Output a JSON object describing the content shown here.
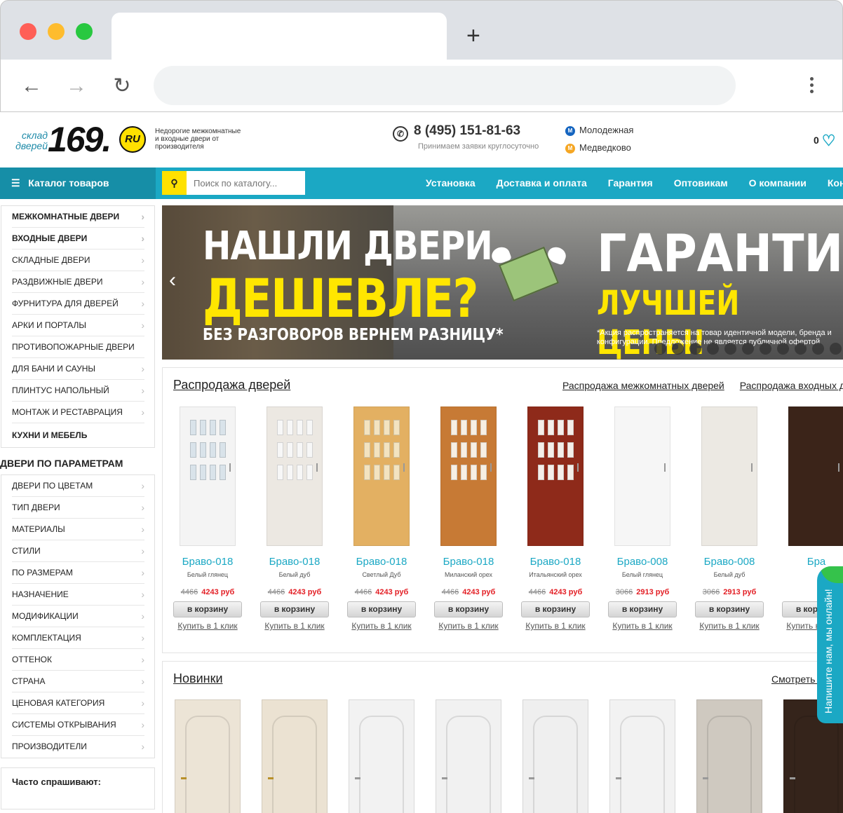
{
  "header": {
    "logo_top": "склад",
    "logo_bottom": "дверей",
    "logo_number": "169.",
    "logo_ru": "RU",
    "tagline": "Недорогие межкомнатные и входные двери от производителя",
    "phone": "8 (495) 151-81-63",
    "phone_note": "Принимаем заявки круглосуточно",
    "metro": [
      {
        "letter": "M",
        "name": "Молодежная",
        "color": "#1565c0"
      },
      {
        "letter": "M",
        "name": "Медведково",
        "color": "#f5a623"
      }
    ],
    "favorites_count": "0"
  },
  "nav": {
    "catalog_label": "Каталог товаров",
    "search_placeholder": "Поиск по каталогу...",
    "menu": [
      "Установка",
      "Доставка и оплата",
      "Гарантия",
      "Оптовикам",
      "О компании",
      "Кон"
    ]
  },
  "sidebar": {
    "catalog": [
      {
        "label": "МЕЖКОМНАТНЫЕ ДВЕРИ",
        "bold": true,
        "arrow": true
      },
      {
        "label": "ВХОДНЫЕ ДВЕРИ",
        "bold": true,
        "arrow": true
      },
      {
        "label": "СКЛАДНЫЕ ДВЕРИ",
        "bold": false,
        "arrow": true
      },
      {
        "label": "РАЗДВИЖНЫЕ ДВЕРИ",
        "bold": false,
        "arrow": true
      },
      {
        "label": "ФУРНИТУРА ДЛЯ ДВЕРЕЙ",
        "bold": false,
        "arrow": true
      },
      {
        "label": "АРКИ И ПОРТАЛЫ",
        "bold": false,
        "arrow": true
      },
      {
        "label": "ПРОТИВОПОЖАРНЫЕ ДВЕРИ",
        "bold": false,
        "arrow": false
      },
      {
        "label": "ДЛЯ БАНИ И САУНЫ",
        "bold": false,
        "arrow": true
      },
      {
        "label": "ПЛИНТУС НАПОЛЬНЫЙ",
        "bold": false,
        "arrow": true
      },
      {
        "label": "МОНТАЖ И РЕСТАВРАЦИЯ",
        "bold": false,
        "arrow": true
      },
      {
        "label": "КУХНИ И МЕБЕЛЬ",
        "bold": true,
        "arrow": false
      }
    ],
    "params_title": "ДВЕРИ ПО ПАРАМЕТРАМ",
    "params": [
      "ДВЕРИ ПО ЦВЕТАМ",
      "ТИП ДВЕРИ",
      "МАТЕРИАЛЫ",
      "СТИЛИ",
      "ПО РАЗМЕРАМ",
      "НАЗНАЧЕНИЕ",
      "МОДИФИКАЦИИ",
      "КОМПЛЕКТАЦИЯ",
      "ОТТЕНОК",
      "СТРАНА",
      "ЦЕНОВАЯ КАТЕГОРИЯ",
      "СИСТЕМЫ ОТКРЫВАНИЯ",
      "ПРОИЗВОДИТЕЛИ"
    ],
    "faq_title": "Часто спрашивают:"
  },
  "banner": {
    "line1": "НАШЛИ ДВЕРИ",
    "line2": "ДЕШЕВЛЕ?",
    "line3": "БЕЗ РАЗГОВОРОВ ВЕРНЕМ РАЗНИЦУ*",
    "right1": "ГАРАНТИЯ",
    "right2": "ЛУЧШЕЙ ЦЕНЫ!",
    "note": "*Акция распространяется на товар идентичной модели, бренда и конфигурации. Предложение не является публичной офертой"
  },
  "sale": {
    "title": "Распродажа дверей",
    "links": [
      "Распродажа межкомнатных дверей",
      "Распродажа входных д"
    ],
    "cart_label": "в корзину",
    "oneclick_label": "Купить в 1 клик",
    "products": [
      {
        "name": "Браво-018",
        "color": "Белый глянец",
        "old": "4466",
        "new": "4243 руб",
        "fill": "#f4f4f4",
        "glass": "#d9e3ea"
      },
      {
        "name": "Браво-018",
        "color": "Белый дуб",
        "old": "4466",
        "new": "4243 руб",
        "fill": "#ece8e2",
        "glass": "#f7f7f7"
      },
      {
        "name": "Браво-018",
        "color": "Светлый Дуб",
        "old": "4466",
        "new": "4243 руб",
        "fill": "#e3b062",
        "glass": "#f3e3c0"
      },
      {
        "name": "Браво-018",
        "color": "Миланский орех",
        "old": "4466",
        "new": "4243 руб",
        "fill": "#c77a35",
        "glass": "#f7efe3"
      },
      {
        "name": "Браво-018",
        "color": "Итальянский орех",
        "old": "4466",
        "new": "4243 руб",
        "fill": "#8e2a1a",
        "glass": "#f4eee9"
      },
      {
        "name": "Браво-008",
        "color": "Белый глянец",
        "old": "3066",
        "new": "2913 руб",
        "fill": "#f6f6f6",
        "glass": ""
      },
      {
        "name": "Браво-008",
        "color": "Белый дуб",
        "old": "3066",
        "new": "2913 руб",
        "fill": "#ece9e3",
        "glass": ""
      },
      {
        "name": "Бра",
        "color": "",
        "old": "",
        "new": "",
        "fill": "#3b2419",
        "glass": ""
      }
    ]
  },
  "news": {
    "title": "Новинки",
    "link": "Смотреть все н",
    "doors": [
      "#ece4d6",
      "#ebe2d2",
      "#f2f2f2",
      "#f1f1f1",
      "#efefef",
      "#f2f2f2",
      "#cfc9c0",
      "#35241b"
    ]
  },
  "chat": {
    "label": "Напишите нам, мы онлайн!"
  }
}
